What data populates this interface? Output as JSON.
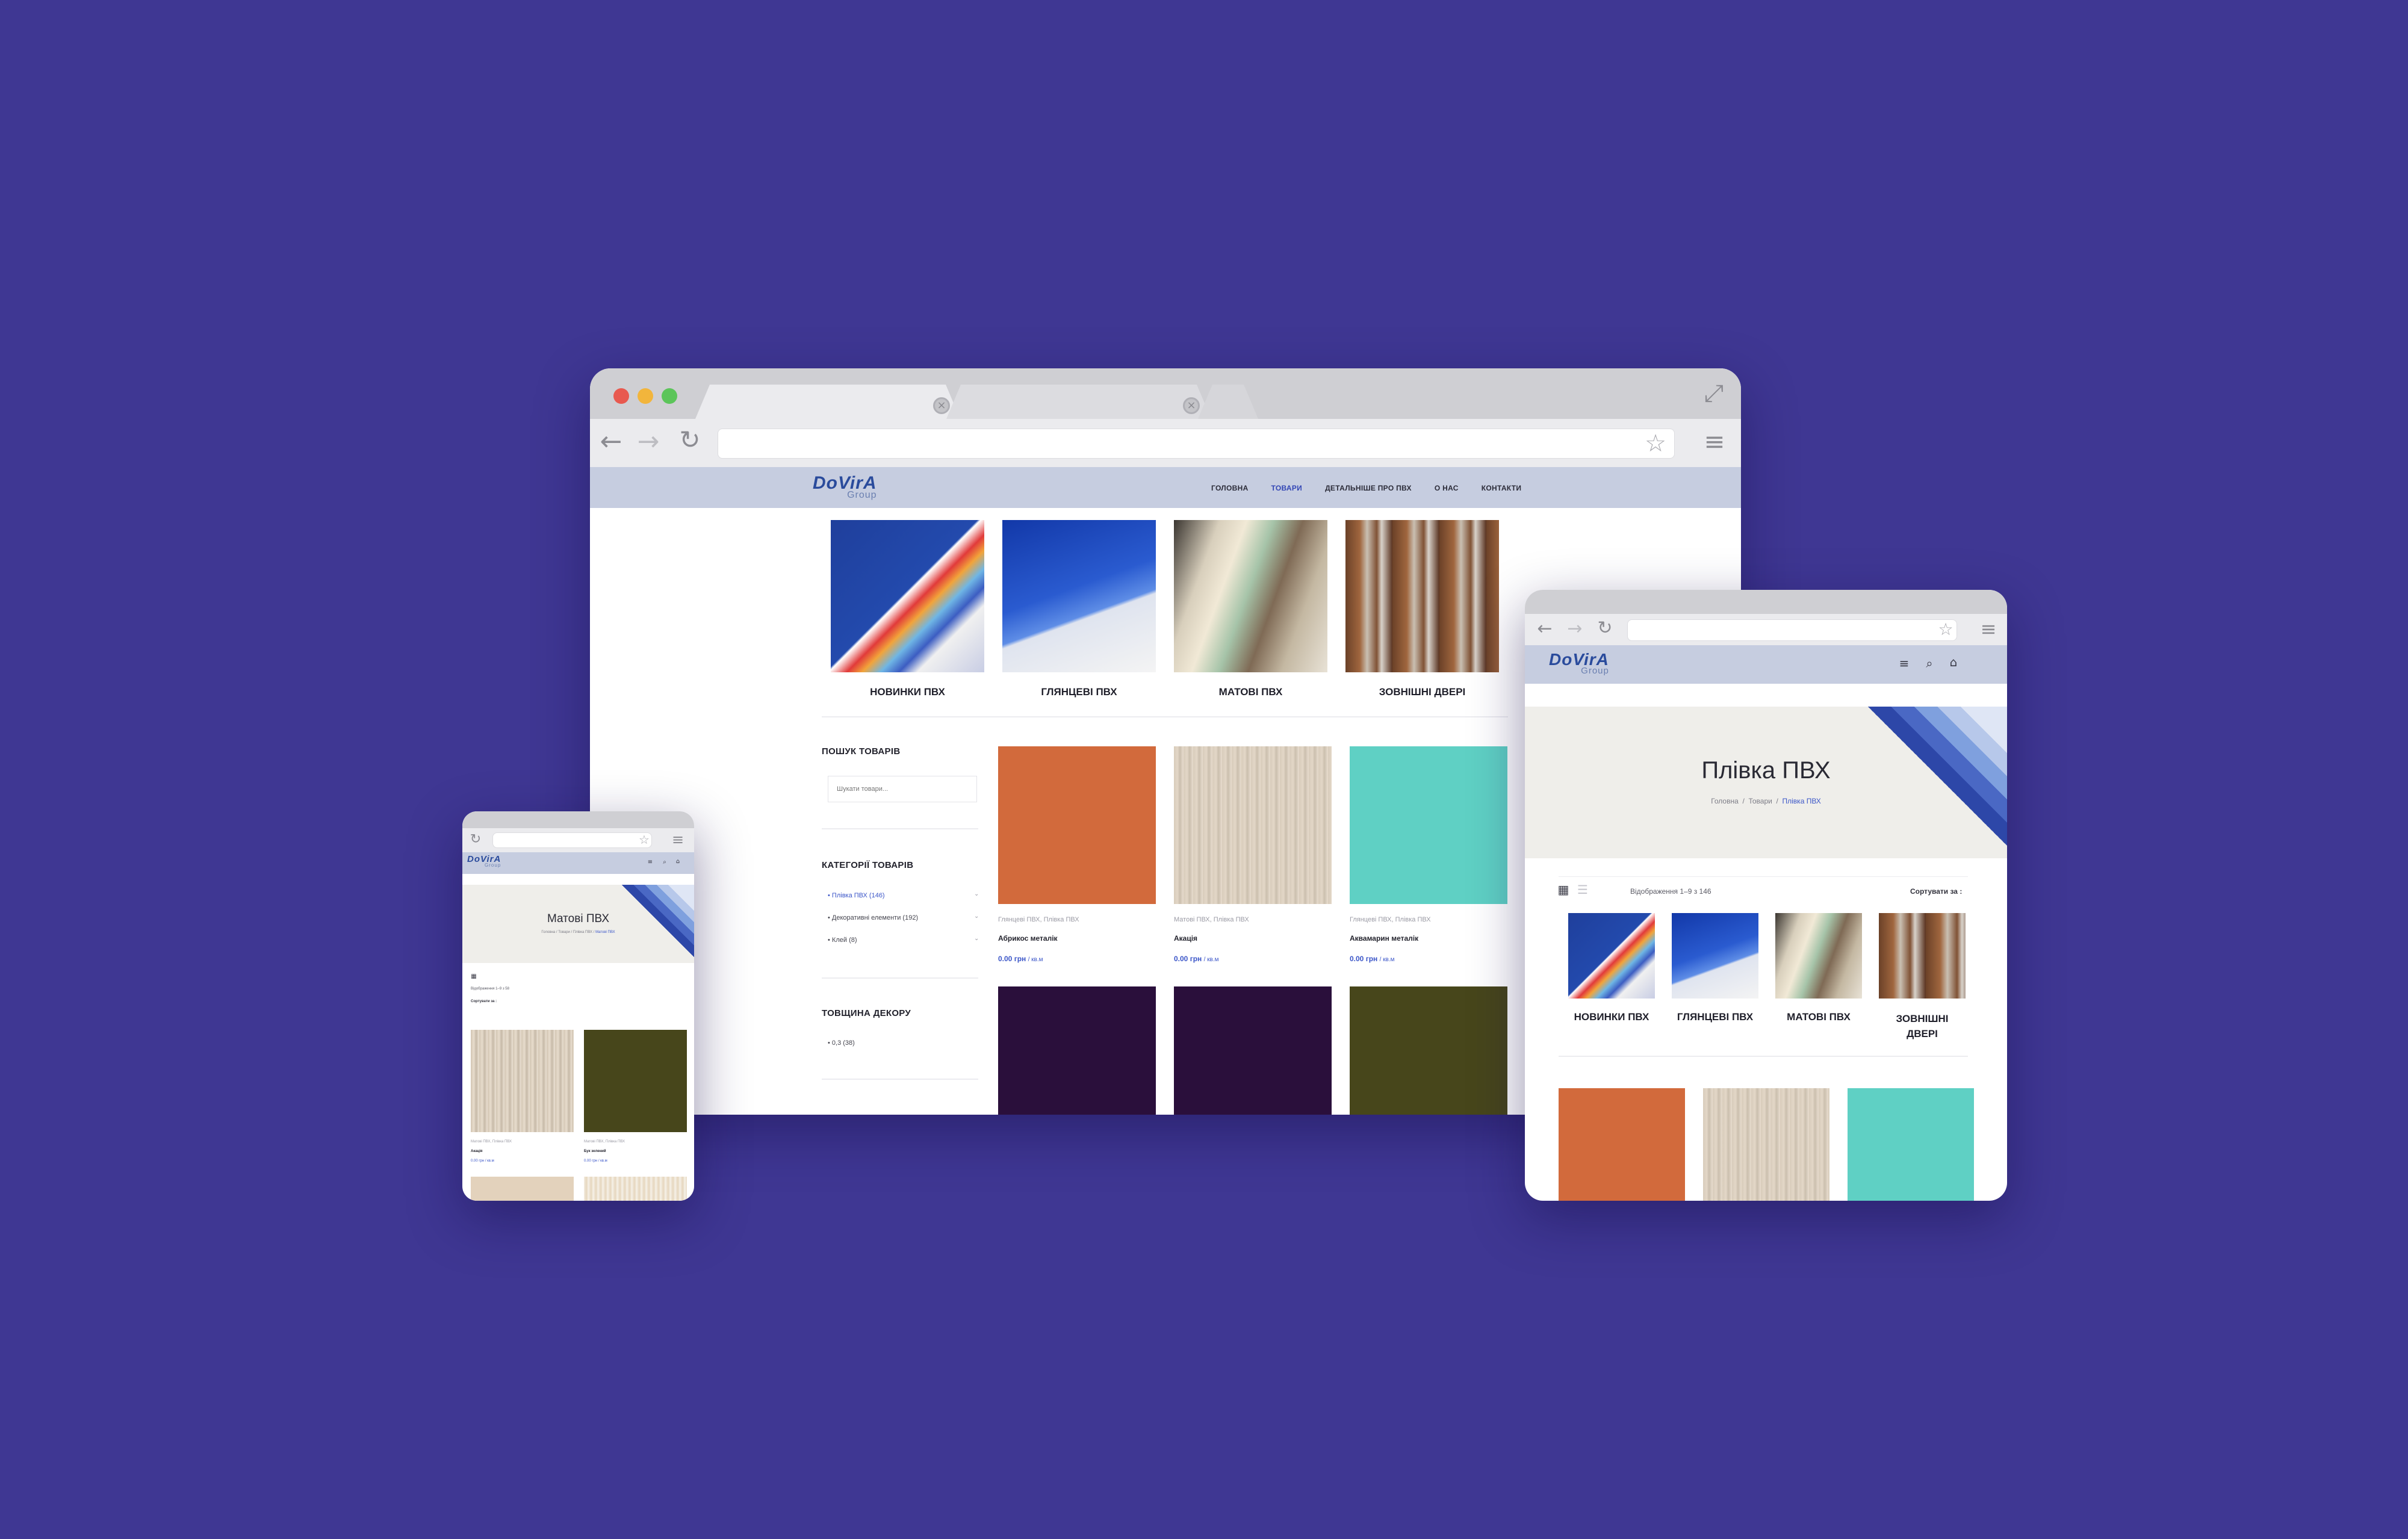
{
  "desktop": {
    "nav": [
      "ГОЛОВНА",
      "ТОВАРИ",
      "ДЕТАЛЬНІШЕ ПРО ПВХ",
      "О НАС",
      "КОНТАКТИ"
    ],
    "logo": "DoVirA",
    "logo_sub": "Group",
    "categories": [
      "НОВИНКИ ПВХ",
      "ГЛЯНЦЕВІ ПВХ",
      "МАТОВІ ПВХ",
      "ЗОВНІШНІ ДВЕРІ"
    ],
    "sidebar": {
      "search_title": "ПОШУК ТОВАРІВ",
      "search_placeholder": "Шукати товари...",
      "cat_title": "КАТЕГОРІЇ ТОВАРІВ",
      "cat_items": [
        "Плівка ПВХ (146)",
        "Декоративні елементи (192)",
        "Клей (8)"
      ],
      "thick_title": "ТОВЩИНА ДЕКОРУ",
      "thick_items": [
        "0,3 (38)"
      ]
    },
    "products": [
      {
        "cats": "Глянцеві ПВХ, Плівка ПВХ",
        "name": "Абрикос металік",
        "price": "0.00 грн",
        "unit": "/ кв.м"
      },
      {
        "cats": "Матові ПВХ, Плівка ПВХ",
        "name": "Акація",
        "price": "0.00 грн",
        "unit": "/ кв.м"
      },
      {
        "cats": "Глянцеві ПВХ, Плівка ПВХ",
        "name": "Аквамарин металік",
        "price": "0.00 грн",
        "unit": "/ кв.м"
      }
    ]
  },
  "tablet": {
    "title": "Плівка ПВХ",
    "crumbs": [
      "Головна",
      "/",
      "Товари",
      "/",
      "Плівка ПВХ"
    ],
    "showing": "Відображення 1–9 з 146",
    "sort": "Сортувати за :",
    "categories": [
      "НОВИНКИ ПВХ",
      "ГЛЯНЦЕВІ ПВХ",
      "МАТОВІ ПВХ",
      "ЗОВНІШНІ ДВЕРІ"
    ]
  },
  "mobile": {
    "title": "Матові ПВХ",
    "crumbs": [
      "Головна",
      "/",
      "Товари",
      "/",
      "Плівка ПВХ",
      "/",
      "Матові ПВХ"
    ],
    "showing": "Відображення 1–9 з 58",
    "sort": "Сортувати за :",
    "products": [
      {
        "cats": "Матові ПВХ, Плівка ПВХ",
        "name": "Акація",
        "price": "0.00 грн / кв.м"
      },
      {
        "cats": "Матові ПВХ, Плівка ПВХ",
        "name": "Бук зелений",
        "price": "0.00 грн / кв.м"
      }
    ]
  },
  "colors": {
    "background": "#3f3793",
    "accent": "#3a55c8",
    "header": "#c6cde0"
  },
  "icons": [
    "back-arrow-icon",
    "forward-arrow-icon",
    "reload-icon",
    "star-icon",
    "menu-icon",
    "expand-icon",
    "search-icon",
    "cart-icon",
    "grid-view-icon",
    "list-view-icon"
  ]
}
